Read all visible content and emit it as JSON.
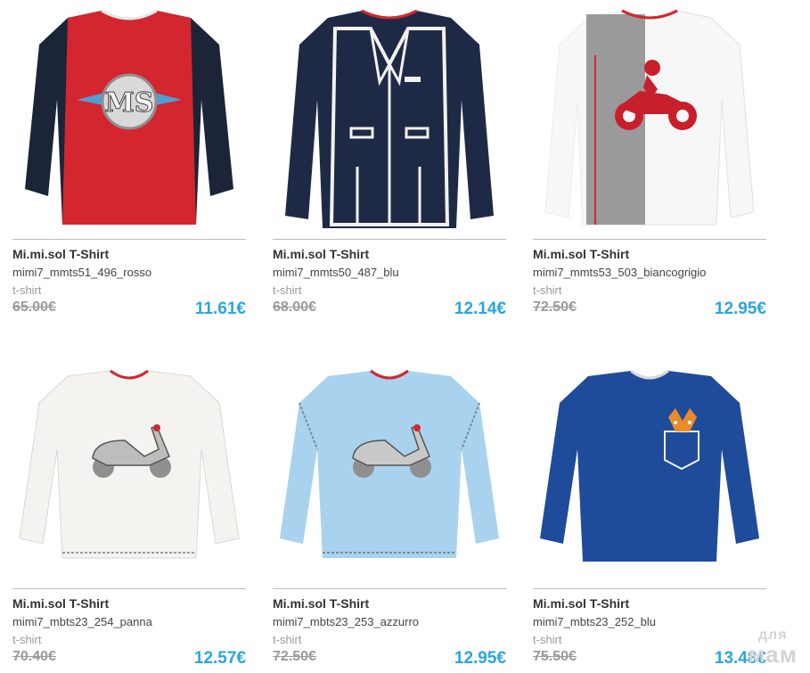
{
  "products": [
    {
      "brand": "Mi.mi.sol T-Shirt",
      "sku": "mimi7_mmts51_496_rosso",
      "category": "t-shirt",
      "old_price": "65.00€",
      "new_price": "11.61€",
      "image": "red-navy-shirt-ms-logo"
    },
    {
      "brand": "Mi.mi.sol T-Shirt",
      "sku": "mimi7_mmts50_487_blu",
      "category": "t-shirt",
      "old_price": "68.00€",
      "new_price": "12.14€",
      "image": "navy-shirt-printed-suit"
    },
    {
      "brand": "Mi.mi.sol T-Shirt",
      "sku": "mimi7_mmts53_503_biancogrigio",
      "category": "t-shirt",
      "old_price": "72.50€",
      "new_price": "12.95€",
      "image": "white-grey-shirt-motorbike"
    },
    {
      "brand": "Mi.mi.sol T-Shirt",
      "sku": "mimi7_mbts23_254_panna",
      "category": "t-shirt",
      "old_price": "70.40€",
      "new_price": "12.57€",
      "image": "cream-shirt-scooter"
    },
    {
      "brand": "Mi.mi.sol T-Shirt",
      "sku": "mimi7_mbts23_253_azzurro",
      "category": "t-shirt",
      "old_price": "72.50€",
      "new_price": "12.95€",
      "image": "lightblue-shirt-scooter"
    },
    {
      "brand": "Mi.mi.sol T-Shirt",
      "sku": "mimi7_mbts23_252_blu",
      "category": "t-shirt",
      "old_price": "75.50€",
      "new_price": "13.48€",
      "image": "blue-shirt-fox-pocket"
    }
  ],
  "watermark": {
    "line1": "для",
    "line2": "мам"
  },
  "colors": {
    "price_new": "#2aa6de",
    "price_old": "#9a9a9a",
    "divider": "#bdbdbd"
  }
}
